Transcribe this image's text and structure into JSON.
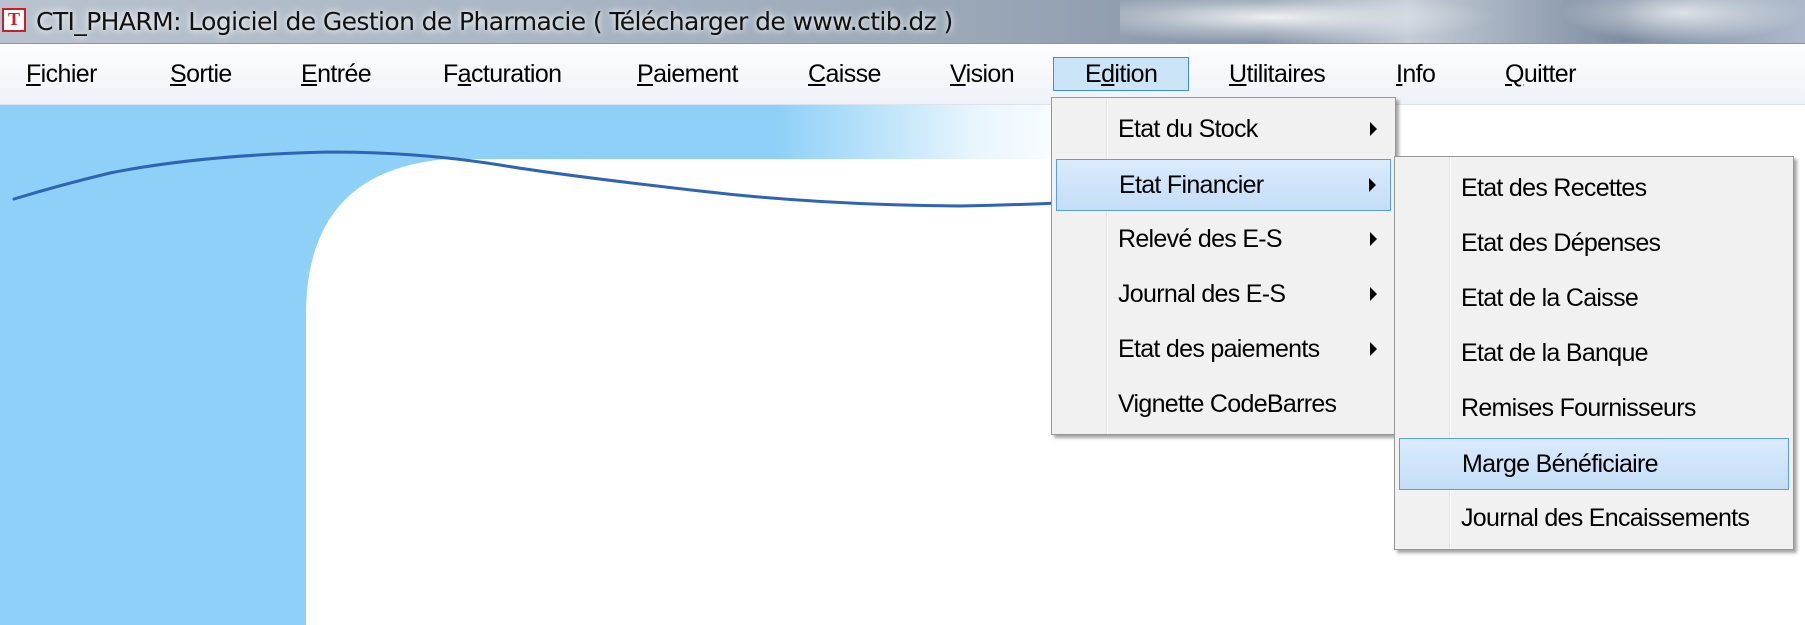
{
  "window": {
    "title": "CTI_PHARM: Logiciel de Gestion de Pharmacie ( Télécharger de www.ctib.dz )",
    "icon_letter": "T",
    "icon": "cti-app-icon"
  },
  "menubar": {
    "items": [
      {
        "pre": "",
        "key": "F",
        "post": "ichier"
      },
      {
        "pre": "",
        "key": "S",
        "post": "ortie"
      },
      {
        "pre": "",
        "key": "E",
        "post": "ntrée"
      },
      {
        "pre": "F",
        "key": "a",
        "post": "cturation"
      },
      {
        "pre": "",
        "key": "P",
        "post": "aiement"
      },
      {
        "pre": "",
        "key": "C",
        "post": "aisse"
      },
      {
        "pre": "",
        "key": "V",
        "post": "ision"
      },
      {
        "pre": "E",
        "key": "d",
        "post": "ition"
      },
      {
        "pre": "",
        "key": "U",
        "post": "tilitaires"
      },
      {
        "pre": "",
        "key": "I",
        "post": "nfo"
      },
      {
        "pre": "",
        "key": "Q",
        "post": "uitter"
      }
    ],
    "active": "Edition"
  },
  "edition_menu": {
    "items": [
      {
        "label": "Etat du Stock",
        "submenu": true
      },
      {
        "label": "Etat Financier",
        "submenu": true,
        "highlighted": true
      },
      {
        "label": "Relevé des E-S",
        "submenu": true
      },
      {
        "label": "Journal des E-S",
        "submenu": true
      },
      {
        "label": "Etat des paiements",
        "submenu": true
      },
      {
        "label": "Vignette CodeBarres",
        "submenu": false
      }
    ]
  },
  "financier_submenu": {
    "items": [
      {
        "label": "Etat des Recettes"
      },
      {
        "label": "Etat des Dépenses"
      },
      {
        "label": "Etat de la Caisse"
      },
      {
        "label": "Etat de la Banque"
      },
      {
        "label": "Remises Fournisseurs"
      },
      {
        "label": "Marge Bénéficiaire",
        "highlighted": true
      },
      {
        "label": "Journal des Encaissements"
      }
    ]
  },
  "colors": {
    "background_blue": "#8ed0f7",
    "curve_line": "#2f64b4",
    "highlight_fill": "#cce4f7",
    "highlight_border": "#3c8fd8"
  }
}
